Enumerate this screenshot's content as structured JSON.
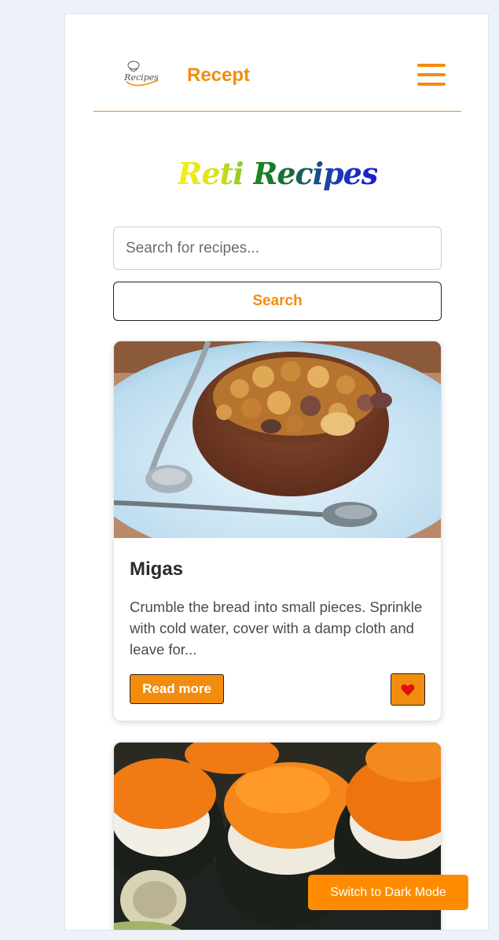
{
  "header": {
    "brand": "Recept",
    "logo_text": "Recipes"
  },
  "hero": {
    "title_word1": "Reti",
    "title_word2": "Recipes"
  },
  "search": {
    "placeholder": "Search for recipes...",
    "value": "",
    "button_label": "Search"
  },
  "recipes": [
    {
      "title": "Migas",
      "description": "Crumble the bread into small pieces. Sprinkle with cold water, cover with a damp cloth and leave for...",
      "read_more_label": "Read more",
      "image_icon": "migas-photo",
      "favorite_icon": "heart-icon"
    },
    {
      "image_icon": "sushi-photo"
    }
  ],
  "theme_toggle": {
    "label": "Switch to Dark Mode"
  },
  "colors": {
    "accent": "#f28c0f",
    "page_bg": "#edf1f8",
    "heart": "#e01010"
  }
}
